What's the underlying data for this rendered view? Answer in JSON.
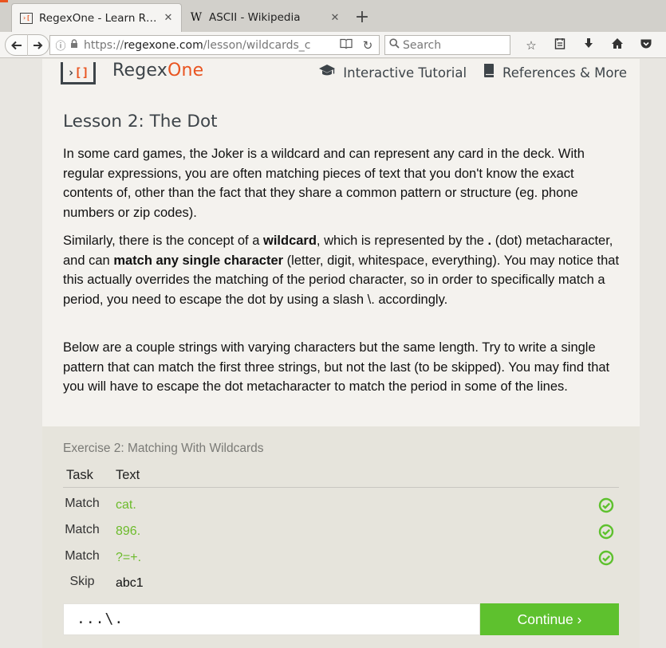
{
  "browser": {
    "tabs": [
      {
        "title": "RegexOne - Learn R…",
        "active": true
      },
      {
        "title": "ASCII - Wikipedia",
        "active": false
      }
    ],
    "url_prefix": "https://",
    "url_host": "regexone.com",
    "url_path": "/lesson/wildcards_c",
    "search_placeholder": "Search"
  },
  "site": {
    "logo_mark": "›[]",
    "logo_name": "Regex",
    "logo_name_accent": "One",
    "nav": [
      {
        "label": "Interactive Tutorial",
        "icon": "graduation-cap-icon"
      },
      {
        "label": "References & More",
        "icon": "book-icon"
      }
    ]
  },
  "lesson": {
    "title": "Lesson 2: The Dot",
    "p1": "In some card games, the Joker is a wildcard and can represent any card in the deck. With regular expressions, you are often matching pieces of text that you don't know the exact contents of, other than the fact that they share a common pattern or structure (eg. phone numbers or zip codes).",
    "p2_a": "Similarly, there is the concept of a ",
    "p2_b": "wildcard",
    "p2_c": ", which is represented by the ",
    "p2_d": ".",
    "p2_e": " (dot) metacharacter, and can ",
    "p2_f": "match any single character",
    "p2_g": " (letter, digit, whitespace, everything). You may notice that this actually overrides the matching of the period character, so in order to specifically match a period, you need to escape the dot by using a slash ",
    "p2_h": "\\.",
    "p2_i": " accordingly.",
    "p3": "Below are a couple strings with varying characters but the same length. Try to write a single pattern that can match the first three strings, but not the last (to be skipped). You may find that you will have to escape the dot metacharacter to match the period in some of the lines."
  },
  "exercise": {
    "title": "Exercise 2: Matching With Wildcards",
    "col_task": "Task",
    "col_text": "Text",
    "rows": [
      {
        "task": "Match",
        "text": "cat.",
        "status": "pass"
      },
      {
        "task": "Match",
        "text": "896.",
        "status": "pass"
      },
      {
        "task": "Match",
        "text": "?=+.",
        "status": "pass"
      },
      {
        "task": "Skip",
        "text": "abc1",
        "status": "none"
      }
    ],
    "input_value": "...\\.",
    "continue_label": "Continue ›"
  },
  "colors": {
    "accent": "#e95420",
    "success": "#5ec12e",
    "match_text": "#6cbb2b"
  }
}
